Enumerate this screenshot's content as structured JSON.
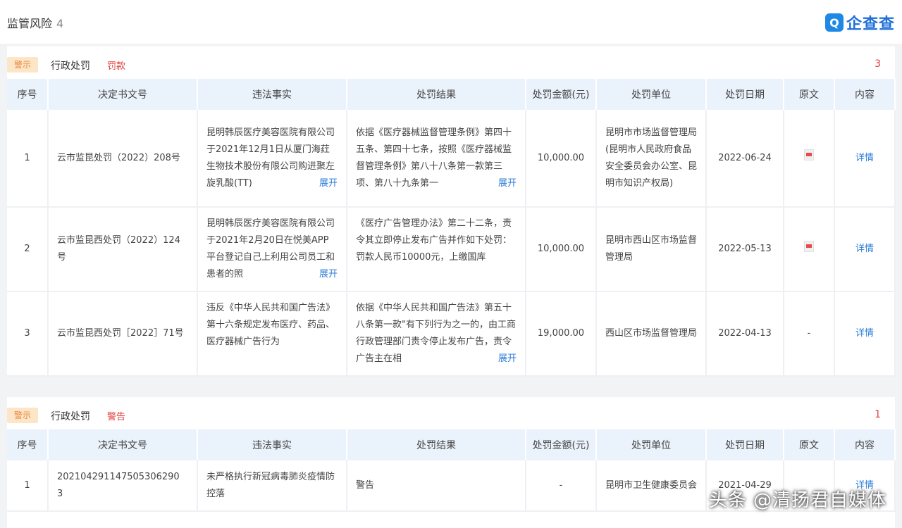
{
  "header": {
    "title": "监管风险",
    "count": "4",
    "logo_mark": "Q",
    "logo_text": "企查查"
  },
  "sections": [
    {
      "tag": "警示",
      "title": "行政处罚",
      "badge": "罚款",
      "count": "3",
      "columns": [
        "序号",
        "决定书文号",
        "违法事实",
        "处罚结果",
        "处罚金额(元)",
        "处罚单位",
        "处罚日期",
        "原文",
        "内容"
      ],
      "rows": [
        {
          "no": "1",
          "doc": "云市监昆处罚（2022）208号",
          "fact": "昆明韩辰医疗美容医院有限公司于2021年12月1日从厦门海荭生物技术股份有限公司购进聚左旋乳酸(TT)",
          "result": "依据《医疗器械监督管理条例》第四十五条、第四十七条，按照《医疗器械监督管理条例》第八十八条第一款第三项、第八十九条第一",
          "amount": "10,000.00",
          "unit": "昆明市市场监督管理局(昆明市人民政府食品安全委员会办公室、昆明市知识产权局)",
          "date": "2022-06-24",
          "original": "pdf",
          "content": "详情"
        },
        {
          "no": "2",
          "doc": "云市监昆西处罚（2022）124号",
          "fact": "昆明韩辰医疗美容医院有限公司于2021年2月20日在悦美APP平台登记自己上利用公司员工和患者的照",
          "result": "《医疗广告管理办法》第二十二条，责令其立即停止发布广告并作如下处罚：罚款人民币10000元，上缴国库",
          "amount": "10,000.00",
          "unit": "昆明市西山区市场监督管理局",
          "date": "2022-05-13",
          "original": "pdf",
          "content": "详情"
        },
        {
          "no": "3",
          "doc": "云市监昆西处罚［2022］71号",
          "fact": "违反《中华人民共和国广告法》第十六条规定发布医疗、药品、医疗器械广告行为",
          "result": "依据《中华人民共和国广告法》第五十八条第一款\"有下列行为之一的，由工商行政管理部门责令停止发布广告，责令广告主在相",
          "amount": "19,000.00",
          "unit": "西山区市场监督管理局",
          "date": "2022-04-13",
          "original": "-",
          "content": "详情"
        }
      ]
    },
    {
      "tag": "警示",
      "title": "行政处罚",
      "badge": "警告",
      "count": "1",
      "columns": [
        "序号",
        "决定书文号",
        "违法事实",
        "处罚结果",
        "处罚金额(元)",
        "处罚单位",
        "处罚日期",
        "原文",
        "内容"
      ],
      "rows": [
        {
          "no": "1",
          "doc": "202104291147505306290 3",
          "fact": "未严格执行新冠病毒肺炎疫情防控落",
          "result": "警告",
          "amount": "-",
          "unit": "昆明市卫生健康委员会",
          "date": "2021-04-29",
          "original": "",
          "content": "详情"
        }
      ]
    }
  ],
  "expand_label": "展开",
  "watermark": "头条 @清扬君自媒体"
}
